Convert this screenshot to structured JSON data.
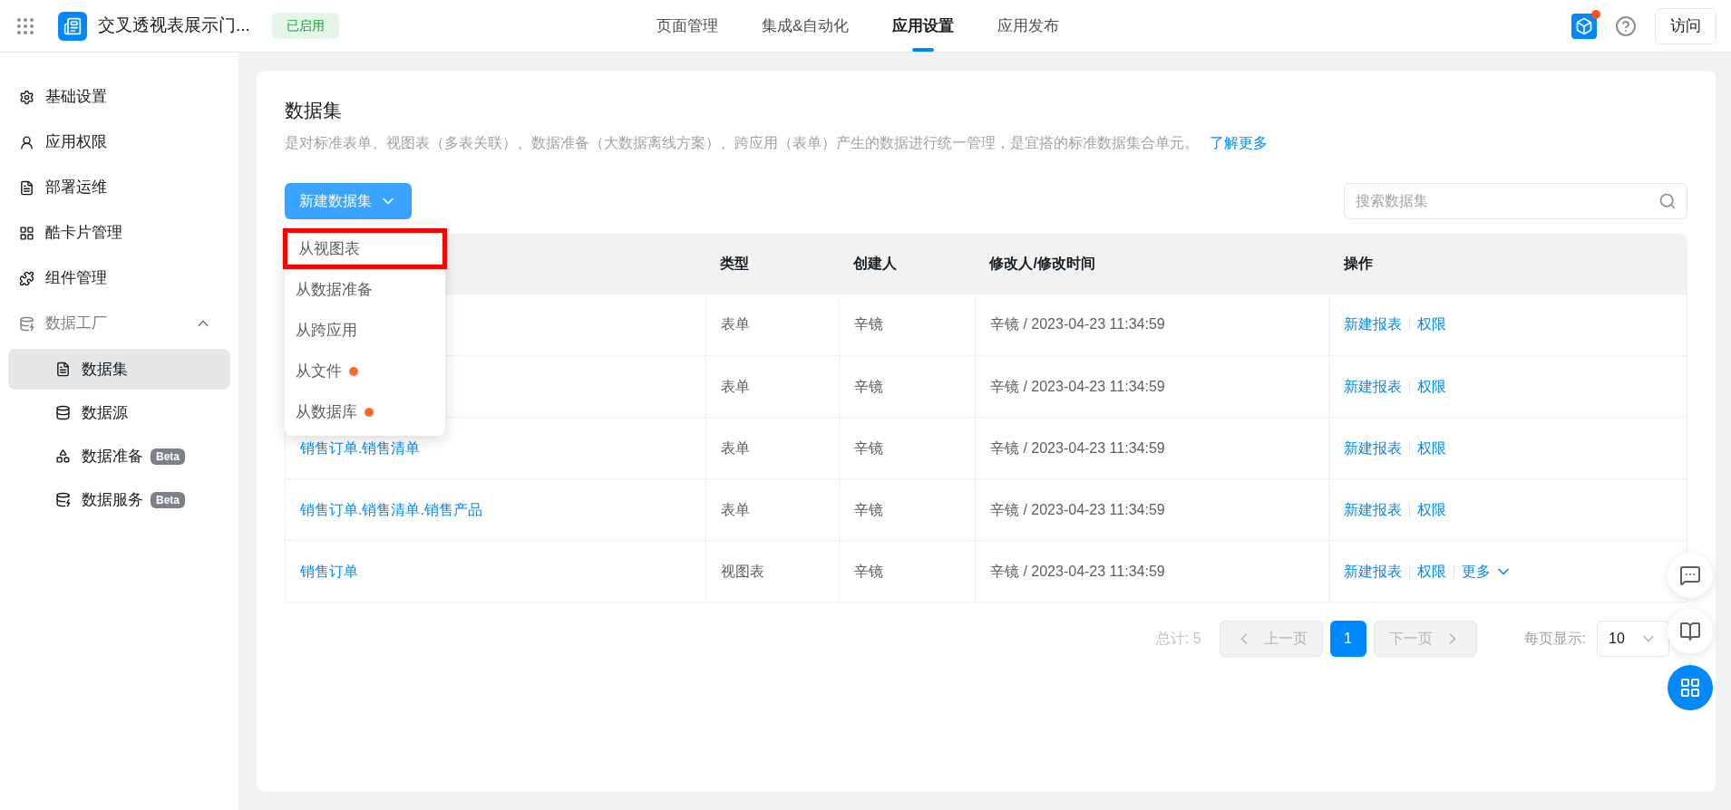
{
  "header": {
    "app_name": "交叉透视表展示门...",
    "status": "已启用",
    "nav": [
      {
        "label": "页面管理",
        "selected": false
      },
      {
        "label": "集成&自动化",
        "selected": false
      },
      {
        "label": "应用设置",
        "selected": true
      },
      {
        "label": "应用发布",
        "selected": false
      }
    ],
    "notification": true,
    "visit_button": "访问"
  },
  "sidebar": {
    "items": [
      {
        "label": "基础设置",
        "selected": false
      },
      {
        "label": "应用权限",
        "selected": false
      },
      {
        "label": "部署运维",
        "selected": false
      },
      {
        "label": "酷卡片管理",
        "selected": false
      },
      {
        "label": "组件管理",
        "selected": false
      },
      {
        "label": "数据工厂",
        "selected": false,
        "expanded": true,
        "children": [
          {
            "label": "数据集",
            "selected": true
          },
          {
            "label": "数据源",
            "selected": false
          },
          {
            "label": "数据准备",
            "selected": false,
            "badge": "Beta"
          },
          {
            "label": "数据服务",
            "selected": false,
            "badge": "Beta"
          }
        ]
      }
    ]
  },
  "page": {
    "title": "数据集",
    "description": "是对标准表单、视图表（多表关联）、数据准备（大数据离线方案）、跨应用（表单）产生的数据进行统一管理，是宜搭的标准数据集合单元。",
    "learn_more": "了解更多",
    "new_button": "新建数据集",
    "search": {
      "placeholder": "搜索数据集"
    },
    "dropdown": [
      {
        "label": "从视图表",
        "highlighted": true,
        "dot": false
      },
      {
        "label": "从数据准备",
        "highlighted": false,
        "dot": false
      },
      {
        "label": "从跨应用",
        "highlighted": false,
        "dot": false
      },
      {
        "label": "从文件",
        "highlighted": false,
        "dot": true
      },
      {
        "label": "从数据库",
        "highlighted": false,
        "dot": true
      }
    ],
    "table": {
      "columns": [
        "类型",
        "创建人",
        "修改人/修改时间",
        "操作"
      ],
      "rows": [
        {
          "type": "表单",
          "creator": "辛镜",
          "modified": "辛镜 / 2023-04-23 11:34:59",
          "actions": [
            "新建报表",
            "权限"
          ]
        },
        {
          "type": "表单",
          "creator": "辛镜",
          "modified": "辛镜 / 2023-04-23 11:34:59",
          "actions": [
            "新建报表",
            "权限"
          ]
        },
        {
          "name": "销售订单.销售清单",
          "type": "表单",
          "creator": "辛镜",
          "modified": "辛镜 / 2023-04-23 11:34:59",
          "actions": [
            "新建报表",
            "权限"
          ]
        },
        {
          "name": "销售订单.销售清单.销售产品",
          "type": "表单",
          "creator": "辛镜",
          "modified": "辛镜 / 2023-04-23 11:34:59",
          "actions": [
            "新建报表",
            "权限"
          ]
        },
        {
          "name": "销售订单",
          "type": "视图表",
          "creator": "辛镜",
          "modified": "辛镜 / 2023-04-23 11:34:59",
          "actions": [
            "新建报表",
            "权限"
          ],
          "more": "更多"
        }
      ]
    },
    "pagination": {
      "total": "总计: 5",
      "prev": {
        "label": "上一页",
        "disabled": true
      },
      "pages": [
        {
          "label": "1",
          "selected": true
        }
      ],
      "next": {
        "label": "下一页",
        "disabled": true
      },
      "per_page_label": "每页显示:",
      "per_page": "10"
    }
  }
}
